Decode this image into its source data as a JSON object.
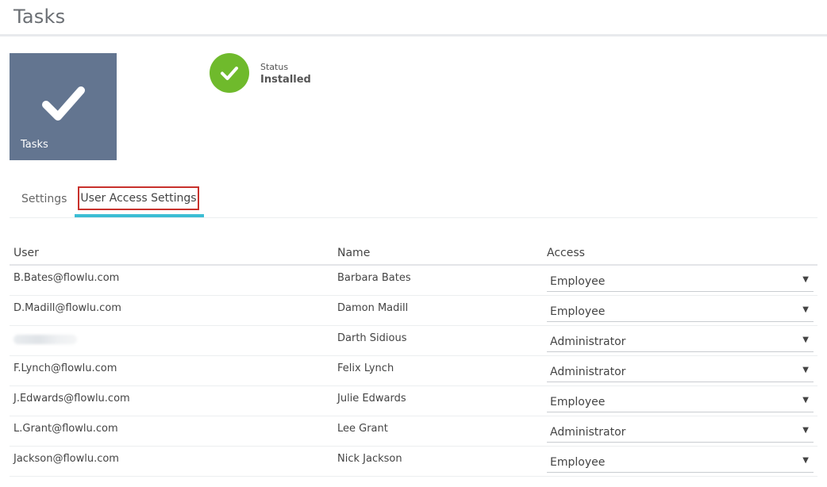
{
  "header": {
    "title": "Tasks"
  },
  "app": {
    "tile_label": "Tasks",
    "tile_color": "#637590",
    "icon": "checkmark-icon"
  },
  "status": {
    "label": "Status",
    "value": "Installed",
    "color": "#6fba2c"
  },
  "tabs": [
    {
      "label": "Settings",
      "active": false
    },
    {
      "label": "User Access Settings",
      "active": true
    }
  ],
  "table": {
    "columns": {
      "user": "User",
      "name": "Name",
      "access": "Access"
    },
    "rows": [
      {
        "user": "B.Bates@flowlu.com",
        "name": "Barbara Bates",
        "access": "Employee"
      },
      {
        "user": "D.Madill@flowlu.com",
        "name": "Damon Madill",
        "access": "Employee"
      },
      {
        "user": "",
        "name": "Darth Sidious",
        "access": "Administrator",
        "user_blurred": true
      },
      {
        "user": "F.Lynch@flowlu.com",
        "name": "Felix Lynch",
        "access": "Administrator"
      },
      {
        "user": "J.Edwards@flowlu.com",
        "name": "Julie Edwards",
        "access": "Employee"
      },
      {
        "user": "L.Grant@flowlu.com",
        "name": "Lee Grant",
        "access": "Administrator"
      },
      {
        "user": "Jackson@flowlu.com",
        "name": "Nick Jackson",
        "access": "Employee"
      }
    ]
  },
  "colors": {
    "tab_active_underline": "#3bbdd4",
    "highlight_box": "#c8312c"
  }
}
